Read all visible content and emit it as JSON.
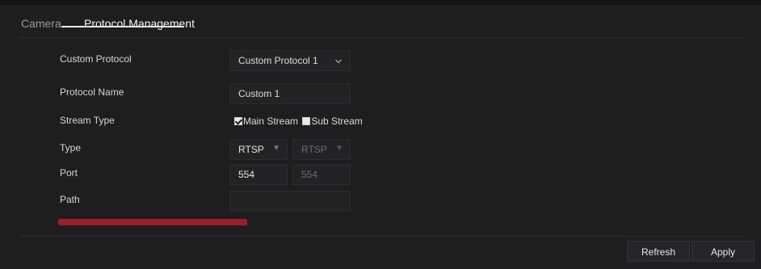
{
  "tabs": [
    {
      "label": "Camera",
      "active": false
    },
    {
      "label": "Protocol Management",
      "active": true
    }
  ],
  "form": {
    "custom_protocol": {
      "label": "Custom Protocol",
      "value": "Custom Protocol 1"
    },
    "protocol_name": {
      "label": "Protocol Name",
      "value": "Custom 1"
    },
    "stream_type": {
      "label": "Stream Type",
      "options": [
        {
          "label": "Main Stream",
          "checked": true
        },
        {
          "label": "Sub Stream",
          "checked": false
        }
      ]
    },
    "type": {
      "label": "Type",
      "main_value": "RTSP",
      "sub_value": "RTSP"
    },
    "port": {
      "label": "Port",
      "main_value": "554",
      "sub_value": "554"
    },
    "path": {
      "label": "Path"
    }
  },
  "buttons": {
    "refresh": "Refresh",
    "apply": "Apply"
  },
  "colors": {
    "background": "#1e1e20",
    "field_background": "#232326",
    "active_tab_underline": "#e9e9e9",
    "path_example_red": "#9c1f25"
  },
  "icons": {
    "dropdown": "chevron-down-icon",
    "small_dropdown": "caret-down-icon"
  }
}
